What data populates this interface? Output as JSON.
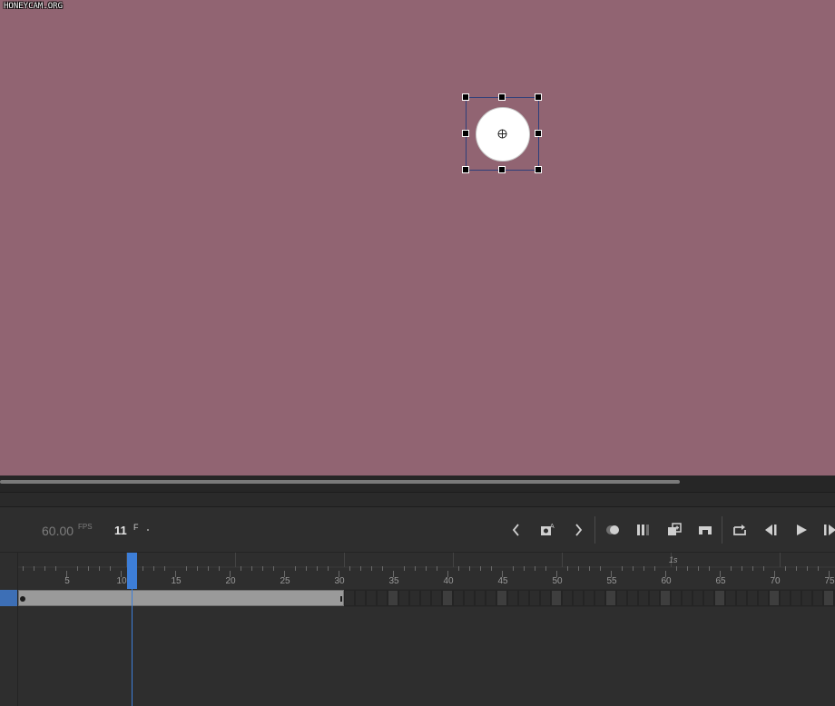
{
  "watermark": "HONEYCAM.ORG",
  "controls": {
    "fps_value": "60.00",
    "fps_unit": "FPS",
    "current_frame": "11",
    "frame_unit": "F"
  },
  "timeline": {
    "second_marker": "1s",
    "tick_labels": [
      "5",
      "10",
      "15",
      "20",
      "25",
      "30",
      "35",
      "40",
      "45",
      "50",
      "55",
      "60",
      "65",
      "70",
      "75"
    ],
    "playhead_frame": 11,
    "span_end_frame": 30
  },
  "icons": {
    "prev_keyframe": "chevron-left-icon",
    "insert_keyframe": "insert-keyframe-icon",
    "next_keyframe": "chevron-right-icon",
    "onion_skin": "onion-skin-icon",
    "edit_multiple": "edit-multiple-frames-icon",
    "paste_frames": "paste-frames-icon",
    "clip_frames": "clip-frames-icon",
    "loop": "loop-icon",
    "step_back": "step-back-icon",
    "play": "play-icon",
    "step_forward": "step-forward-icon"
  },
  "colors": {
    "stage": "#916472",
    "playhead": "#3d7ed8",
    "layer_selected": "#3d6fb6"
  }
}
